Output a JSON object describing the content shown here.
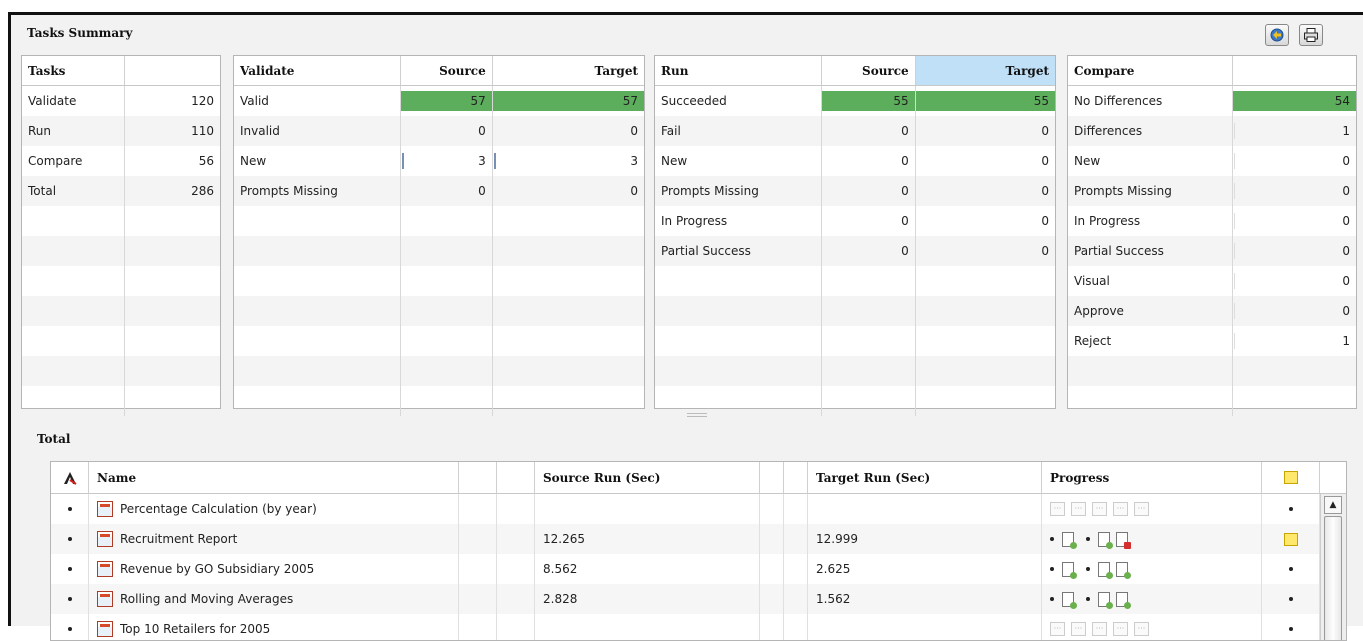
{
  "header": {
    "title": "Tasks Summary"
  },
  "toolbar": {
    "export_icon": "export-icon",
    "print_icon": "print-icon"
  },
  "tasks": {
    "headers": [
      "Tasks",
      ""
    ],
    "rows": [
      {
        "label": "Validate",
        "value": "120"
      },
      {
        "label": "Run",
        "value": "110"
      },
      {
        "label": "Compare",
        "value": "56"
      },
      {
        "label": "Total",
        "value": "286"
      }
    ]
  },
  "validate": {
    "headers": [
      "Validate",
      "Source",
      "Target"
    ],
    "rows": [
      {
        "label": "Valid",
        "source": "57",
        "target": "57",
        "source_fill": 1,
        "target_fill": 1
      },
      {
        "label": "Invalid",
        "source": "0",
        "target": "0",
        "source_fill": 0,
        "target_fill": 0
      },
      {
        "label": "New",
        "source": "3",
        "target": "3",
        "source_fill": 0.05,
        "target_fill": 0.05
      },
      {
        "label": "Prompts Missing",
        "source": "0",
        "target": "0",
        "source_fill": 0,
        "target_fill": 0
      }
    ]
  },
  "run": {
    "headers": [
      "Run",
      "Source",
      "Target"
    ],
    "rows": [
      {
        "label": "Succeeded",
        "source": "55",
        "target": "55",
        "source_fill": 1,
        "target_fill": 1
      },
      {
        "label": "Fail",
        "source": "0",
        "target": "0",
        "source_fill": 0,
        "target_fill": 0
      },
      {
        "label": "New",
        "source": "0",
        "target": "0",
        "source_fill": 0,
        "target_fill": 0
      },
      {
        "label": "Prompts Missing",
        "source": "0",
        "target": "0",
        "source_fill": 0,
        "target_fill": 0
      },
      {
        "label": "In Progress",
        "source": "0",
        "target": "0",
        "source_fill": 0,
        "target_fill": 0
      },
      {
        "label": "Partial Success",
        "source": "0",
        "target": "0",
        "source_fill": 0,
        "target_fill": 0
      }
    ]
  },
  "compare": {
    "headers": [
      "Compare",
      ""
    ],
    "rows": [
      {
        "label": "No Differences",
        "value": "54",
        "fill": 1
      },
      {
        "label": "Differences",
        "value": "1",
        "fill": 0
      },
      {
        "label": "New",
        "value": "0",
        "fill": 0
      },
      {
        "label": "Prompts Missing",
        "value": "0",
        "fill": 0
      },
      {
        "label": "In Progress",
        "value": "0",
        "fill": 0
      },
      {
        "label": "Partial Success",
        "value": "0",
        "fill": 0
      },
      {
        "label": "Visual",
        "value": "0",
        "fill": 0
      },
      {
        "label": "Approve",
        "value": "0",
        "fill": 0
      },
      {
        "label": "Reject",
        "value": "1",
        "fill": 0
      }
    ]
  },
  "total": {
    "title": "Total",
    "headers": {
      "name": "Name",
      "source_run": "Source Run (Sec)",
      "target_run": "Target Run (Sec)",
      "progress": "Progress"
    },
    "rows": [
      {
        "name": "Percentage Calculation (by year)",
        "source_run": "",
        "target_run": "",
        "status": "pending",
        "note": false
      },
      {
        "name": "Recruitment Report",
        "source_run": "12.265",
        "target_run": "12.999",
        "status": "error",
        "note": true
      },
      {
        "name": "Revenue by GO Subsidiary 2005",
        "source_run": "8.562",
        "target_run": "2.625",
        "status": "done",
        "note": false
      },
      {
        "name": "Rolling and Moving Averages",
        "source_run": "2.828",
        "target_run": "1.562",
        "status": "done",
        "note": false
      },
      {
        "name": "Top 10 Retailers for 2005",
        "source_run": "",
        "target_run": "",
        "status": "pending",
        "note": false
      }
    ]
  },
  "colors": {
    "bar": "#5cae5c",
    "selected_header": "#bfe0f7"
  }
}
